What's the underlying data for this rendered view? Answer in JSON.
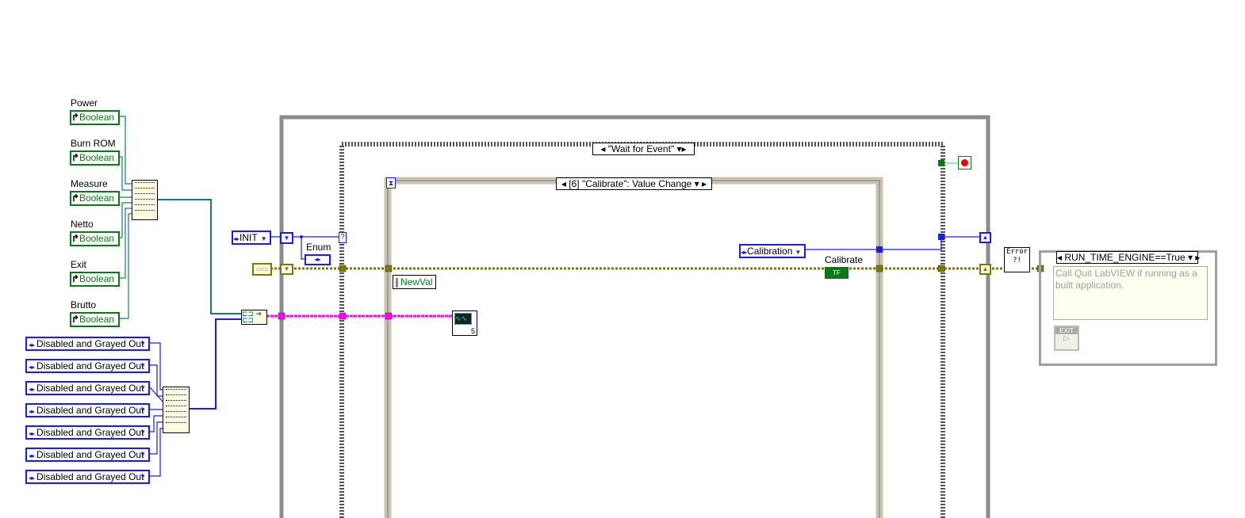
{
  "booleans": [
    {
      "label": "Power",
      "type": "Boolean"
    },
    {
      "label": "Burn ROM",
      "type": "Boolean"
    },
    {
      "label": "Measure",
      "type": "Boolean"
    },
    {
      "label": "Netto",
      "type": "Boolean"
    },
    {
      "label": "Exit",
      "type": "Boolean"
    },
    {
      "label": "Brutto",
      "type": "Boolean"
    }
  ],
  "rings": [
    "Disabled and Grayed Out",
    "Disabled and Grayed Out",
    "Disabled and Grayed Out",
    "Disabled and Grayed Out",
    "Disabled and Grayed Out",
    "Disabled and Grayed Out",
    "Disabled and Grayed Out"
  ],
  "init_enum": "INIT",
  "enum_label": "Enum",
  "case_unknown": "?",
  "event_selector": "\"Wait for Event\"",
  "event_case": "[6] \"Calibrate\": Value Change",
  "newval": "NewVal",
  "graph_icon_num": "5",
  "calibration_ring": "Calibration",
  "calibrate_label": "Calibrate",
  "tf": "TF",
  "error_icon": "Error ?!",
  "case_selector": "RUN_TIME_ENGINE==True",
  "comment": "Call Quit LabVIEW if running as a built application.",
  "exit_icon": "EXIT",
  "colors": {
    "boolean": "#0a7a17",
    "enum": "#1a1aff",
    "error": "#7a7a00",
    "refnum": "#ff00ff",
    "loop": "#8c8c8c"
  }
}
